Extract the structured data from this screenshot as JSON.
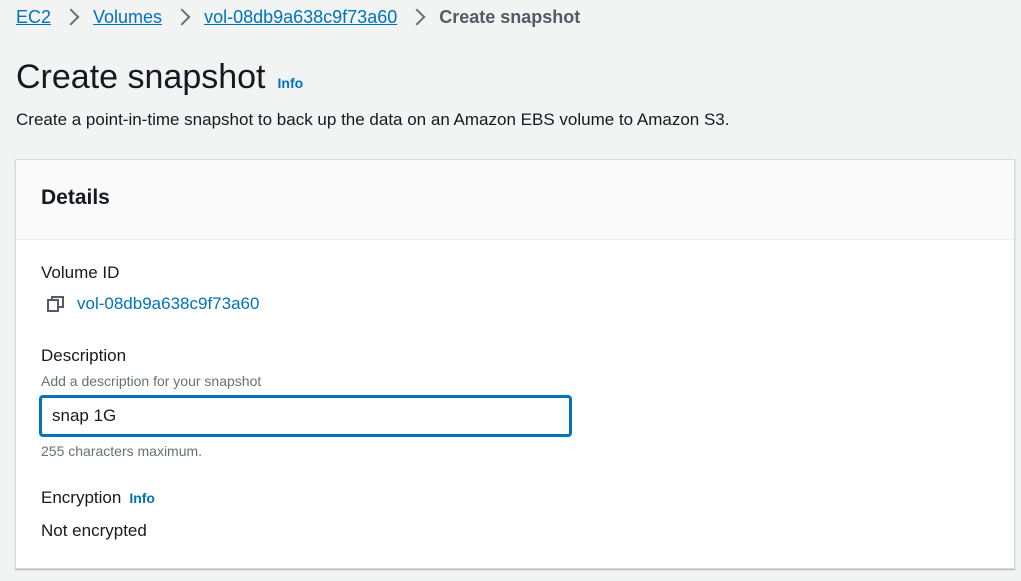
{
  "breadcrumb": {
    "items": [
      "EC2",
      "Volumes",
      "vol-08db9a638c9f73a60"
    ],
    "current": "Create snapshot"
  },
  "header": {
    "title": "Create snapshot",
    "info": "Info",
    "description": "Create a point-in-time snapshot to back up the data on an Amazon EBS volume to Amazon S3."
  },
  "details": {
    "title": "Details",
    "volume_id_label": "Volume ID",
    "volume_id": "vol-08db9a638c9f73a60",
    "description_label": "Description",
    "description_hint": "Add a description for your snapshot",
    "description_value": "snap 1G",
    "description_constraint": "255 characters maximum.",
    "encryption_label": "Encryption",
    "encryption_info": "Info",
    "encryption_value": "Not encrypted"
  },
  "colors": {
    "link": "#0073bb",
    "background": "#f2f3f3",
    "text": "#16191f",
    "secondary_text": "#687078"
  },
  "icons": {
    "copy": "copy-icon",
    "chevron": "chevron-right-icon"
  }
}
